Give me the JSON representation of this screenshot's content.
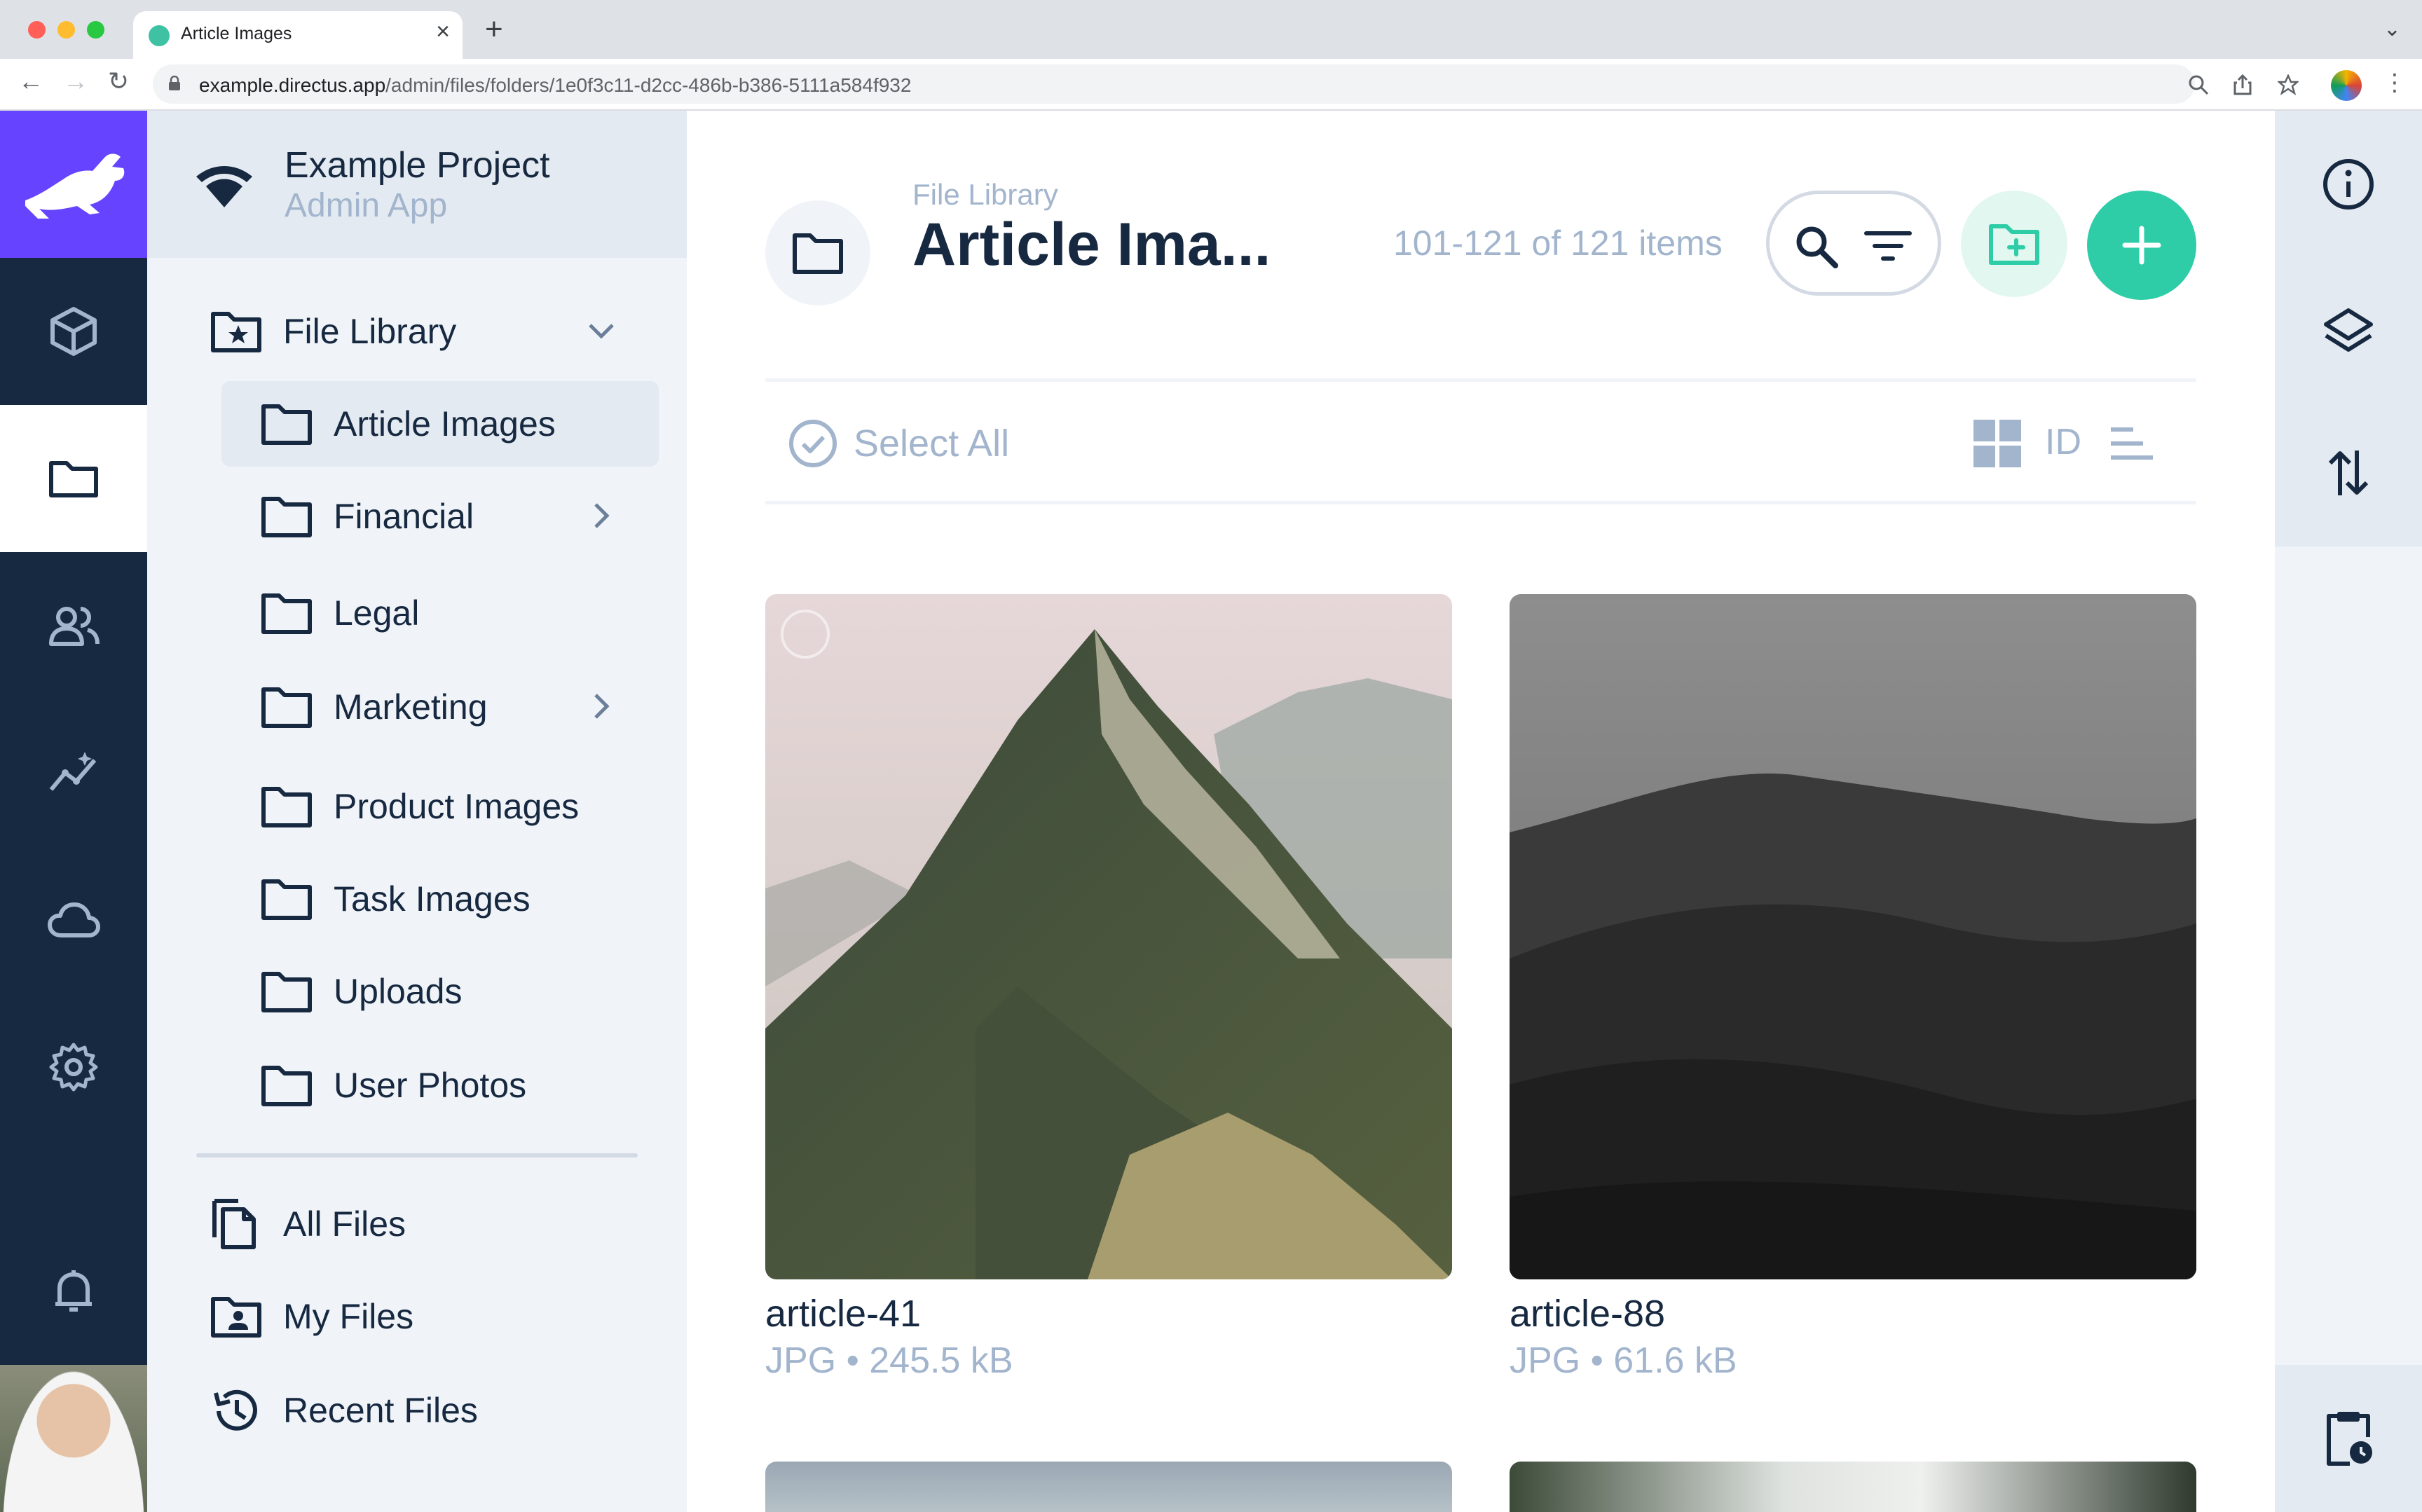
{
  "browser": {
    "tab_title": "Article Images",
    "url_host": "example.directus.app",
    "url_path": "/admin/files/folders/1e0f3c11-d2cc-486b-b386-5111a584f932"
  },
  "project": {
    "name": "Example Project",
    "subtitle": "Admin App"
  },
  "navigation": {
    "root": {
      "label": "File Library"
    },
    "folders": [
      {
        "label": "Article Images",
        "active": true,
        "has_children": false
      },
      {
        "label": "Financial",
        "active": false,
        "has_children": true
      },
      {
        "label": "Legal",
        "active": false,
        "has_children": false
      },
      {
        "label": "Marketing",
        "active": false,
        "has_children": true
      },
      {
        "label": "Product Images",
        "active": false,
        "has_children": false
      },
      {
        "label": "Task Images",
        "active": false,
        "has_children": false
      },
      {
        "label": "Uploads",
        "active": false,
        "has_children": false
      },
      {
        "label": "User Photos",
        "active": false,
        "has_children": false
      }
    ],
    "shortcuts": [
      {
        "label": "All Files",
        "icon": "files-icon"
      },
      {
        "label": "My Files",
        "icon": "folder-user-icon"
      },
      {
        "label": "Recent Files",
        "icon": "history-icon"
      }
    ]
  },
  "modules": [
    {
      "name": "content",
      "icon": "cube-icon"
    },
    {
      "name": "files",
      "icon": "folder-icon",
      "active": true
    },
    {
      "name": "users",
      "icon": "users-icon"
    },
    {
      "name": "insights",
      "icon": "insights-icon"
    },
    {
      "name": "cloud",
      "icon": "cloud-icon"
    },
    {
      "name": "settings",
      "icon": "gear-icon"
    },
    {
      "name": "notifications",
      "icon": "bell-icon"
    }
  ],
  "header": {
    "breadcrumb": "File Library",
    "title": "Article Ima...",
    "count": "101-121 of 121 items"
  },
  "toolbar": {
    "select_all": "Select All",
    "sort_field": "ID"
  },
  "files": [
    {
      "name": "article-41",
      "type": "JPG",
      "size": "245.5 kB"
    },
    {
      "name": "article-88",
      "type": "JPG",
      "size": "61.6 kB"
    }
  ],
  "sidebar": [
    {
      "name": "info",
      "icon": "info-icon"
    },
    {
      "name": "layout",
      "icon": "layers-icon"
    },
    {
      "name": "import-export",
      "icon": "sort-arrows-icon"
    },
    {
      "name": "activity",
      "icon": "clipboard-clock-icon"
    }
  ],
  "colors": {
    "brand": "#6644ff",
    "primary": "#2ecda7",
    "module_bg": "#172940",
    "nav_bg": "#f0f4f9",
    "muted_text": "#a2b5cd"
  }
}
